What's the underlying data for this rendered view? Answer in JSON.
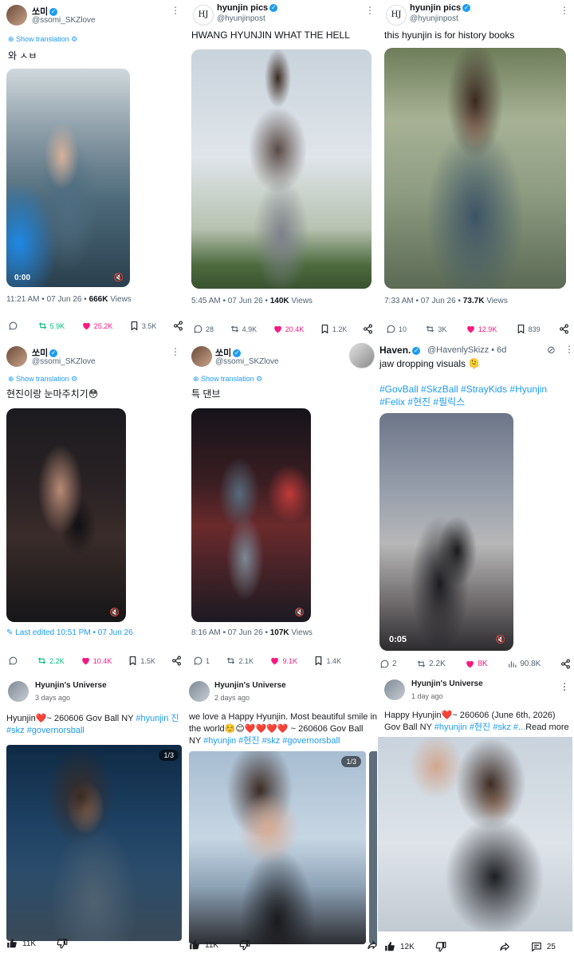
{
  "cells": [
    {
      "id": "c1",
      "name": "쏘미",
      "handle": "@ssomi_SKZlove",
      "show_translation": "Show translation",
      "text": "와 ㅅㅂ",
      "video_time": "0:00",
      "meta_time": "11:21 AM • 07 Jun 26 •",
      "meta_views": "666K",
      "meta_views_label": "Views",
      "replies": "",
      "reposts": "5.9K",
      "likes": "25.2K",
      "bookmarks": "3.5K"
    },
    {
      "id": "c2",
      "name": "hyunjin pics",
      "handle": "@hyunjinpost",
      "avatar_text": "HJ",
      "text": "HWANG HYUNJIN WHAT THE HELL",
      "meta_time": "5:45 AM • 07 Jun 26 •",
      "meta_views": "140K",
      "meta_views_label": "Views",
      "replies": "28",
      "reposts": "4.9K",
      "likes": "20.4K",
      "bookmarks": "1.2K"
    },
    {
      "id": "c3",
      "name": "hyunjin pics",
      "handle": "@hyunjinpost",
      "avatar_text": "HJ",
      "text": "this hyunjin is for history books",
      "meta_time": "7:33 AM • 07 Jun 26 •",
      "meta_views": "73.7K",
      "meta_views_label": "Views",
      "replies": "10",
      "reposts": "3K",
      "likes": "12.9K",
      "bookmarks": "839"
    },
    {
      "id": "c4",
      "name": "쏘미",
      "handle": "@ssomi_SKZlove",
      "show_translation": "Show translation",
      "text": "현진이랑 눈마주치기😳",
      "edited": "Last edited 10:51 PM • 07 Jun 26",
      "replies": "",
      "reposts": "2.2K",
      "likes": "10.4K",
      "bookmarks": "1.5K"
    },
    {
      "id": "c5",
      "name": "쏘미",
      "handle": "@ssomi_SKZlove",
      "show_translation": "Show translation",
      "text": "특 댄브",
      "meta_time": "8:16 AM • 07 Jun 26 •",
      "meta_views": "107K",
      "meta_views_label": "Views",
      "replies": "1",
      "reposts": "2.1K",
      "likes": "9.1K",
      "bookmarks": "1.4K"
    },
    {
      "id": "c6",
      "name": "Haven.",
      "handle": "@HavenlySkizz • 6d",
      "text": "jaw dropping visuals 🫠",
      "hashtags": "#GovBall #SkzBall #StrayKids #Hyunjin #Felix #현진 #필릭스",
      "video_time": "0:05",
      "replies": "2",
      "reposts": "2.2K",
      "likes": "8K",
      "views": "90.8K"
    },
    {
      "id": "c7",
      "name": "Hyunjin's Universe",
      "time": "3 days ago",
      "text_plain": "Hyunjin❤️~ 260606 Gov Ball NY ",
      "text_tags": "#hyunjin 진 #skz #governorsball",
      "counter": "1/3",
      "likes": "11K"
    },
    {
      "id": "c8",
      "name": "Hyunjin's Universe",
      "time": "2 days ago",
      "text_plain": "we love a Happy Hyunjin. Most beautiful smile in the world☺️😊❤️❤️❤️❤️ ~ 260606 Gov Ball NY ",
      "text_tags": "#hyunjin #현진 #skz #governorsball",
      "counter": "1/3",
      "likes": "11K"
    },
    {
      "id": "c9",
      "name": "Hyunjin's Universe",
      "time": "1 day ago",
      "text_plain": "Happy Hyunjin❤️~ 260606 (June 6th, 2026) Gov Ball NY ",
      "text_tags": "#hyunjin #현진 #skz #...",
      "read_more": "Read more",
      "likes": "12K",
      "comments": "25"
    }
  ],
  "colors": {
    "twitter_blue": "#1d9bf0",
    "repost_green": "#00ba7c",
    "like_pink": "#f91880",
    "secondary": "#536471"
  }
}
